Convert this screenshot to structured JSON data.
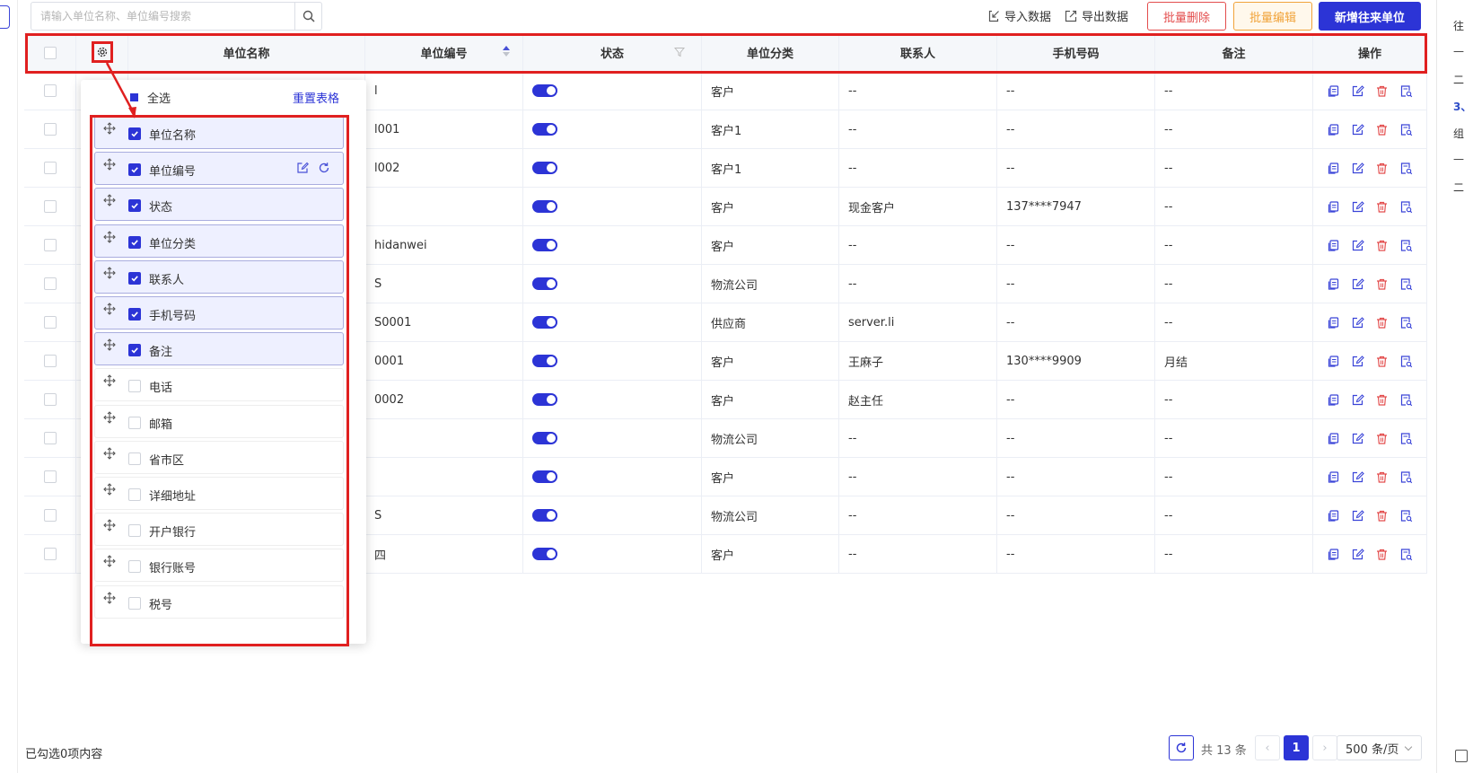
{
  "toolbar": {
    "search_placeholder": "请输入单位名称、单位编号搜索",
    "import_label": "导入数据",
    "export_label": "导出数据",
    "batch_delete_label": "批量删除",
    "batch_edit_label": "批量编辑",
    "add_label": "新增往来单位"
  },
  "table": {
    "columns": [
      "单位名称",
      "单位编号",
      "状态",
      "单位分类",
      "联系人",
      "手机号码",
      "备注",
      "操作"
    ],
    "rows": [
      {
        "code": "l",
        "category": "客户",
        "contact": "--",
        "phone": "--",
        "remark": "--"
      },
      {
        "code": "l001",
        "category": "客户1",
        "contact": "--",
        "phone": "--",
        "remark": "--"
      },
      {
        "code": "l002",
        "category": "客户1",
        "contact": "--",
        "phone": "--",
        "remark": "--"
      },
      {
        "code": "",
        "category": "客户",
        "contact": "现金客户",
        "phone": "137****7947",
        "remark": "--"
      },
      {
        "code": "hidanwei",
        "category": "客户",
        "contact": "--",
        "phone": "--",
        "remark": "--"
      },
      {
        "code": "S",
        "category": "物流公司",
        "contact": "--",
        "phone": "--",
        "remark": "--"
      },
      {
        "code": "S0001",
        "category": "供应商",
        "contact": "server.li",
        "phone": "--",
        "remark": "--"
      },
      {
        "code": "0001",
        "category": "客户",
        "contact": "王麻子",
        "phone": "130****9909",
        "remark": "月结"
      },
      {
        "code": "0002",
        "category": "客户",
        "contact": "赵主任",
        "phone": "--",
        "remark": "--"
      },
      {
        "code": "",
        "category": "物流公司",
        "contact": "--",
        "phone": "--",
        "remark": "--"
      },
      {
        "code": "",
        "category": "客户",
        "contact": "--",
        "phone": "--",
        "remark": "--"
      },
      {
        "code": "S",
        "category": "物流公司",
        "contact": "--",
        "phone": "--",
        "remark": "--"
      },
      {
        "code": "四",
        "category": "客户",
        "contact": "--",
        "phone": "--",
        "remark": "--"
      }
    ]
  },
  "column_panel": {
    "select_all_label": "全选",
    "reset_label": "重置表格",
    "items": [
      {
        "label": "单位名称",
        "checked": true
      },
      {
        "label": "单位编号",
        "checked": true
      },
      {
        "label": "状态",
        "checked": true
      },
      {
        "label": "单位分类",
        "checked": true
      },
      {
        "label": "联系人",
        "checked": true
      },
      {
        "label": "手机号码",
        "checked": true
      },
      {
        "label": "备注",
        "checked": true
      },
      {
        "label": "电话",
        "checked": false
      },
      {
        "label": "邮箱",
        "checked": false
      },
      {
        "label": "省市区",
        "checked": false
      },
      {
        "label": "详细地址",
        "checked": false
      },
      {
        "label": "开户银行",
        "checked": false
      },
      {
        "label": "银行账号",
        "checked": false
      },
      {
        "label": "税号",
        "checked": false
      }
    ]
  },
  "footer": {
    "selected_text": "已勾选0项内容",
    "total_text": "共 13 条",
    "current_page": "1",
    "page_size": "500 条/页"
  },
  "right_rail": {
    "lines": [
      "往",
      "—",
      "二",
      "3、",
      "组",
      "—",
      "二"
    ]
  },
  "colors": {
    "primary": "#2c34d6",
    "danger": "#e34d4d",
    "warning": "#f1a33a",
    "highlight": "#e02020"
  }
}
